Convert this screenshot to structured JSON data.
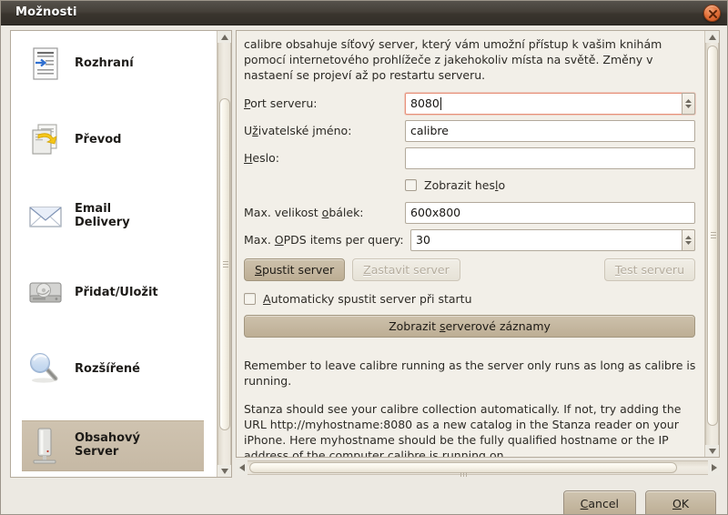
{
  "window": {
    "title": "Možnosti",
    "close_icon": "close-icon"
  },
  "sidebar": {
    "items": [
      {
        "label": "Rozhraní",
        "icon": "interface-icon"
      },
      {
        "label": "Převod",
        "icon": "convert-icon"
      },
      {
        "label": "Email\nDelivery",
        "icon": "envelope-icon"
      },
      {
        "label": "Přidat/Uložit",
        "icon": "harddisk-icon"
      },
      {
        "label": "Rozšířené",
        "icon": "magnifier-icon"
      },
      {
        "label": "Obsahový\nServer",
        "icon": "server-icon",
        "selected": true
      }
    ]
  },
  "main": {
    "intro": "calibre obsahuje síťový server, který vám umožní přístup k vašim knihám pomocí internetového prohlížeče z jakehokoliv místa na světě. Změny v nastaení se projeví až po restartu serveru.",
    "fields": [
      {
        "label": "Port serveru:",
        "value": "8080",
        "spinner": true,
        "focused": true
      },
      {
        "label": "Uživatelské jméno:",
        "value": "calibre",
        "spinner": false,
        "focused": false
      },
      {
        "label": "Heslo:",
        "value": "",
        "spinner": false,
        "focused": false
      },
      {
        "label": "Max. velikost obálek:",
        "value": "600x800",
        "spinner": false,
        "focused": false
      },
      {
        "label": "Max. OPDS items per query:",
        "value": "30",
        "spinner": true,
        "focused": false
      }
    ],
    "show_password_checkbox": {
      "label": "Zobrazit heslo",
      "checked": false
    },
    "autostart_checkbox": {
      "label": "Automaticky spustit server při startu",
      "checked": false
    },
    "buttons": {
      "start": "Spustit server",
      "stop": "Zastavit server",
      "test": "Test serveru",
      "logs": "Zobrazit serverové záznamy"
    },
    "note_1": "Remember to leave calibre running as the server only runs as long as calibre is running.",
    "note_2": "Stanza should see your calibre collection automatically. If not, try adding the URL http://myhostname:8080 as a new catalog in the Stanza reader on your iPhone. Here myhostname should be the fully qualified hostname or the IP address of the computer calibre is running on."
  },
  "footer": {
    "cancel": "Cancel",
    "ok": "OK"
  },
  "colors": {
    "titlebar": "#3a352e",
    "accent_close": "#e3713a",
    "selection": "#c6b9a5",
    "window_bg": "#ece9e2",
    "panel_bg": "#f2efe8",
    "focus_border": "#e8917a"
  }
}
